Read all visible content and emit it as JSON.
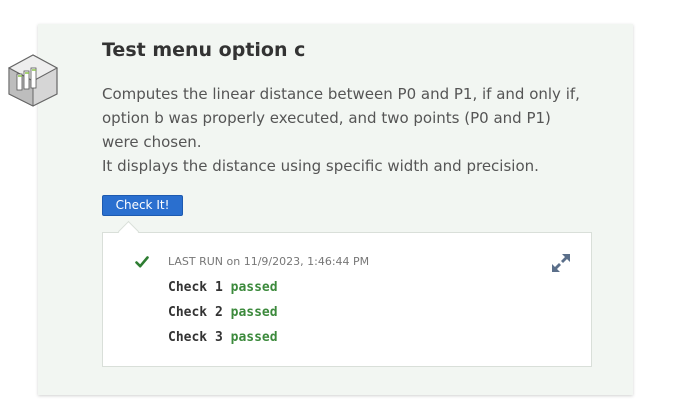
{
  "task": {
    "title": "Test menu option c",
    "description_lines": [
      "Computes the linear distance between P0 and P1, if and only if, option b was properly executed, and two points (P0 and P1) were chosen.",
      "It displays the distance using specific width and precision."
    ],
    "check_button_label": "Check It!",
    "icon": "stairs-task-icon"
  },
  "result": {
    "last_run_label": "LAST RUN",
    "last_run_date": "on 11/9/2023, 1:46:44 PM",
    "status_icon": "checkmark-icon",
    "expand_icon": "expand-arrows-icon",
    "checks": [
      {
        "label": "Check 1",
        "status": "passed"
      },
      {
        "label": "Check 2",
        "status": "passed"
      },
      {
        "label": "Check 3",
        "status": "passed"
      }
    ]
  },
  "colors": {
    "card_bg": "#f2f6f2",
    "button": "#2a6fcf",
    "passed": "#3c8a3c",
    "checkmark": "#2e7d32"
  }
}
